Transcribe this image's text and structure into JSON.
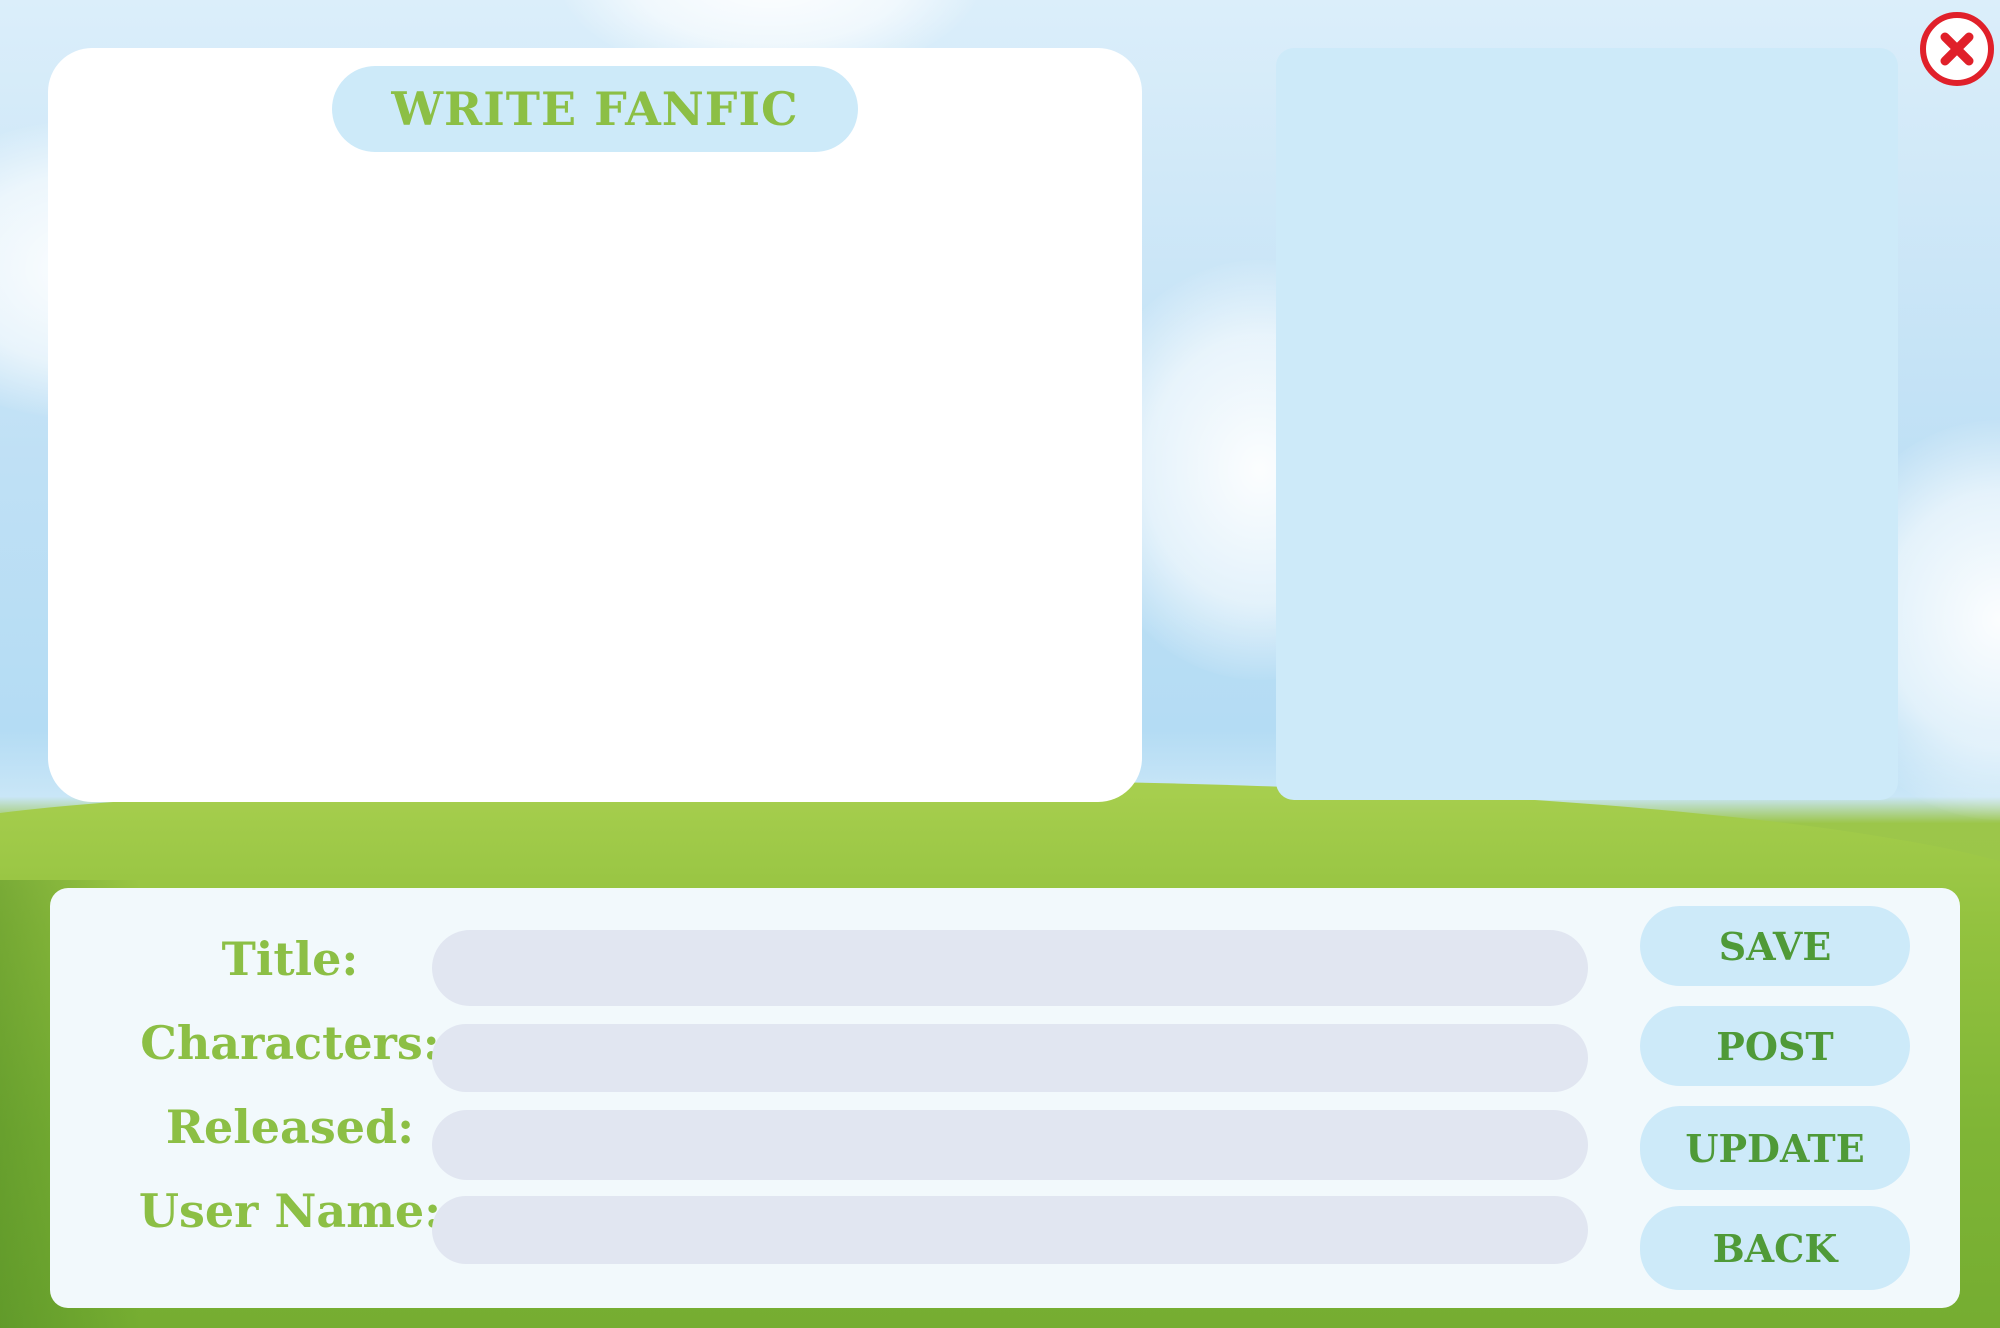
{
  "header": {
    "title": "WRITE FANFIC"
  },
  "form": {
    "fields": [
      {
        "label": "Title:",
        "value": "",
        "placeholder": ""
      },
      {
        "label": "Characters:",
        "value": "",
        "placeholder": ""
      },
      {
        "label": "Released:",
        "value": "",
        "placeholder": ""
      },
      {
        "label": "User Name:",
        "value": "",
        "placeholder": ""
      }
    ]
  },
  "actions": {
    "save": "SAVE",
    "post": "POST",
    "update": "UPDATE",
    "back": "BACK"
  },
  "icons": {
    "close": "close-icon"
  },
  "colors": {
    "accent_green": "#8cbf45",
    "button_text_green": "#4f9a38",
    "pill_blue": "#cdeaf9",
    "input_gray": "#e1e6f1",
    "close_red": "#e0202a"
  }
}
